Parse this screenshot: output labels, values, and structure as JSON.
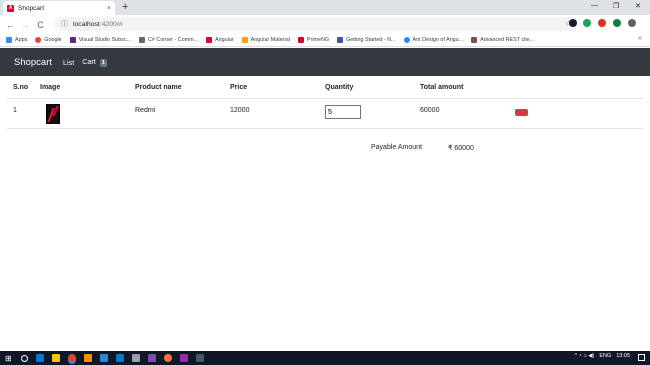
{
  "browser": {
    "tab_title": "Shopcart",
    "tab_close": "×",
    "new_tab": "+",
    "minimize": "—",
    "maximize": "❐",
    "close": "✕",
    "back": "←",
    "forward": "→",
    "reload": "C",
    "lock": "ⓘ",
    "url_host": "localhost",
    "url_path": ":4200/#",
    "star": "☆",
    "more": "»"
  },
  "bookmarks": [
    {
      "label": "Apps",
      "color": "#4285f4"
    },
    {
      "label": "Google",
      "color": "#ea4335"
    },
    {
      "label": "Visual Studio Subsc...",
      "color": "#68217a"
    },
    {
      "label": "C# Corner - Comm...",
      "color": "#666666"
    },
    {
      "label": "Angular",
      "color": "#dd0031"
    },
    {
      "label": "Angular Material",
      "color": "#ffa000"
    },
    {
      "label": "PrimeNG",
      "color": "#dd0031"
    },
    {
      "label": "Getting Started - N...",
      "color": "#3f51b5"
    },
    {
      "label": "Ant Design of Angu...",
      "color": "#1890ff"
    },
    {
      "label": "Advanced REST clie...",
      "color": "#795548"
    }
  ],
  "navbar": {
    "brand": "Shopcart",
    "list_link": "List",
    "cart_link": "Cart",
    "cart_count": "1"
  },
  "table": {
    "headers": [
      "S.no",
      "Image",
      "Product name",
      "Price",
      "Quantity",
      "Total amount"
    ],
    "rows": [
      {
        "sno": "1",
        "product_name": "Redmi",
        "price": "12000",
        "quantity": "5",
        "total": "60000"
      }
    ]
  },
  "summary": {
    "label": "Payable Amount",
    "value": "₹ 60000"
  },
  "taskbar": {
    "start": "⊞",
    "lang": "ENG",
    "time": "13:05",
    "tray": "^ ◔ ⌂ ◀)"
  },
  "colors": {
    "navbar_bg": "#343a40",
    "delete_button": "#dc3545",
    "taskbar_bg": "#101827"
  }
}
